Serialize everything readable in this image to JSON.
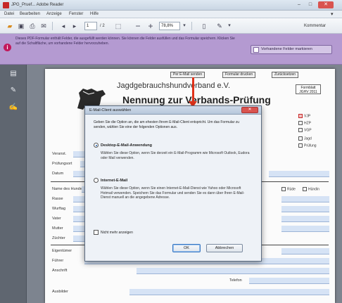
{
  "window": {
    "title": "JPG_Pruef... Adobe Reader",
    "minimize_glyph": "–",
    "maximize_glyph": "□",
    "close_glyph": "✕"
  },
  "menubar": {
    "items": [
      "Datei",
      "Bearbeiten",
      "Anzeige",
      "Fenster",
      "Hilfe"
    ],
    "chevron_glyph": "▾"
  },
  "toolbar": {
    "page_current": "1",
    "page_total": "/ 2",
    "zoom": "78,8%",
    "comment_label": "Kommentar"
  },
  "form_notice": {
    "icon_glyph": "i",
    "message": "Dieses PDF-Formular enthält Felder, die ausgefüllt werden können. Sie können die Felder ausfüllen und das Formular speichern. Klicken Sie auf die Schaltfläche, um vorhandene Felder hervorzuheben.",
    "highlight_button": "Vorhandene Felder markieren"
  },
  "navpane": {
    "icons": [
      "pages-icon",
      "attachment-icon",
      "signature-icon"
    ],
    "glyphs": [
      "▤",
      "✎",
      "✍"
    ]
  },
  "document": {
    "top_buttons": [
      "Per E-Mail senden",
      "Formular drucken",
      "Zurücksetzen"
    ],
    "org": "Jagdgebrauchshundverband e.V.",
    "heading": "Nennung zur Verbands-Prüfung",
    "right_box": "Formblatt\nJGHV 2011",
    "right_checks": [
      "VJP",
      "HZP",
      "VGP"
    ],
    "right_checks_2": [
      "Jagd",
      "Prüfung"
    ],
    "labels": [
      "Veranst.",
      "Prüfungsort",
      "Datum",
      "Name des Hundes",
      "Rasse",
      "Wurftag",
      "Vater",
      "Mutter",
      "Züchter",
      "Eigentümer",
      "Führer",
      "Anschrift"
    ],
    "extra_labels": [
      "Rüde",
      "Hündin",
      "Telefon",
      "Telefon"
    ],
    "bottom_label": "Anschrift",
    "bottom_label_2": "Ausbilder"
  },
  "dialog": {
    "title": "E-Mail-Client auswählen",
    "close_glyph": "✕",
    "intro": "Geben Sie die Option an, die am ehesten Ihrem E-Mail-Client entspricht. Um das Formular zu senden, wählen Sie eine der folgenden Optionen aus.",
    "option1_label": "Desktop-E-Mail-Anwendung",
    "option1_desc": "Wählen Sie diese Option, wenn Sie derzeit ein E-Mail-Programm wie Microsoft Outlook, Eudora oder Mail verwenden.",
    "option2_label": "Internet-E-Mail",
    "option2_desc": "Wählen Sie diese Option, wenn Sie einen Internet-E-Mail-Dienst wie Yahoo oder Microsoft Hotmail verwenden. Speichern Sie das Formular und senden Sie es dann über Ihren E-Mail-Dienst manuell an die angegebene Adresse.",
    "checkbox_label": "Nicht mehr anzeigen",
    "ok": "OK",
    "cancel": "Abbrechen"
  },
  "colors": {
    "form_notice_bg": "#b49ad1",
    "dialog_bg": "#eef2f7",
    "arrow": "#e0321a",
    "field": "#d6e3f5"
  }
}
